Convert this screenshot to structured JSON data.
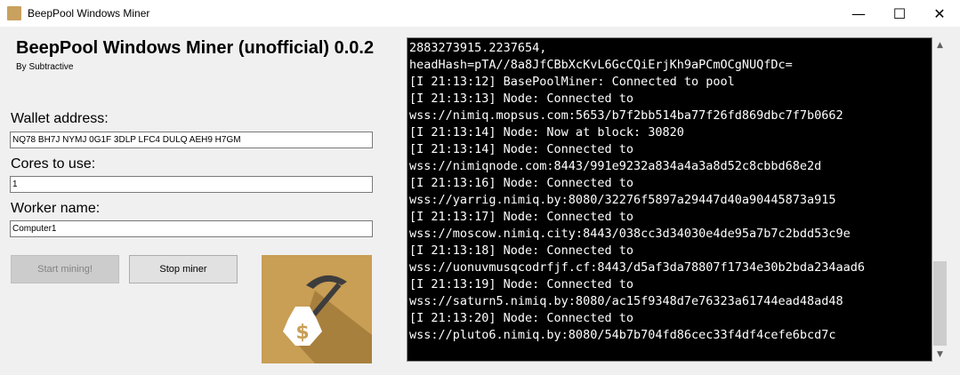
{
  "window": {
    "title": "BeepPool Windows Miner",
    "minimize_glyph": "—",
    "maximize_glyph": "☐",
    "close_glyph": "✕"
  },
  "header": {
    "title": "BeepPool Windows Miner (unofficial) 0.0.2",
    "byline": "By Subtractive"
  },
  "form": {
    "wallet_label": "Wallet address:",
    "wallet_value": "NQ78 BH7J NYMJ 0G1F 3DLP LFC4 DULQ AEH9 H7GM",
    "cores_label": "Cores to use:",
    "cores_value": "1",
    "worker_label": "Worker name:",
    "worker_value": "Computer1"
  },
  "buttons": {
    "start_label": "Start mining!",
    "stop_label": "Stop miner"
  },
  "logo": {
    "icon": "money-bag-pickaxe-icon",
    "symbol": "$",
    "colors": {
      "background": "#c99e55",
      "shadow": "#a8803d",
      "bag": "#ffffff",
      "symbol": "#c99e55",
      "pickaxe": "#3d3d3d"
    }
  },
  "console": {
    "lines": [
      "2883273915.2237654,",
      "headHash=pTA//8a8JfCBbXcKvL6GcCQiErjKh9aPCmOCgNUQfDc=",
      "[I 21:13:12] BasePoolMiner: Connected to pool",
      "[I 21:13:13] Node: Connected to",
      "wss://nimiq.mopsus.com:5653/b7f2bb514ba77f26fd869dbc7f7b0662",
      "[I 21:13:14] Node: Now at block: 30820",
      "[I 21:13:14] Node: Connected to",
      "wss://nimiqnode.com:8443/991e9232a834a4a3a8d52c8cbbd68e2d",
      "[I 21:13:16] Node: Connected to",
      "wss://yarrig.nimiq.by:8080/32276f5897a29447d40a90445873a915",
      "[I 21:13:17] Node: Connected to",
      "wss://moscow.nimiq.city:8443/038cc3d34030e4de95a7b7c2bdd53c9e",
      "[I 21:13:18] Node: Connected to",
      "wss://uonuvmusqcodrfjf.cf:8443/d5af3da78807f1734e30b2bda234aad6",
      "[I 21:13:19] Node: Connected to",
      "wss://saturn5.nimiq.by:8080/ac15f9348d7e76323a61744ead48ad48",
      "[I 21:13:20] Node: Connected to",
      "wss://pluto6.nimiq.by:8080/54b7b704fd86cec33f4df4cefe6bcd7c"
    ]
  },
  "scrollbar": {
    "up_glyph": "▲",
    "down_glyph": "▼",
    "scroll_position": 1.0
  }
}
